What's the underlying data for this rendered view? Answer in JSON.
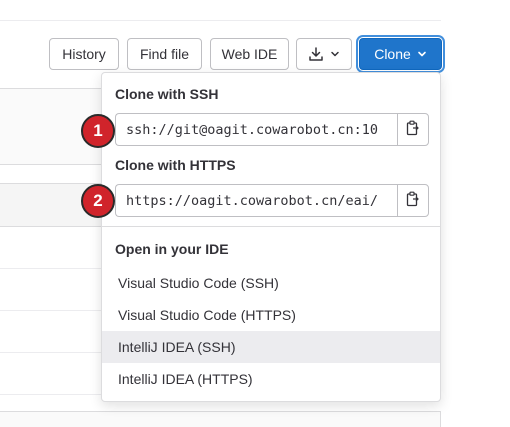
{
  "toolbar": {
    "history_label": "History",
    "find_file_label": "Find file",
    "web_ide_label": "Web IDE",
    "download_icon": "download-icon",
    "clone_label": "Clone",
    "accent_color": "#1f75cb"
  },
  "clone_dropdown": {
    "ssh": {
      "title": "Clone with SSH",
      "url": "ssh://git@oagit.cowarobot.cn:10",
      "copy_icon": "copy-to-clipboard-icon"
    },
    "https": {
      "title": "Clone with HTTPS",
      "url": "https://oagit.cowarobot.cn/eai/",
      "copy_icon": "copy-to-clipboard-icon"
    },
    "ide": {
      "title": "Open in your IDE",
      "items": [
        {
          "label": "Visual Studio Code (SSH)"
        },
        {
          "label": "Visual Studio Code (HTTPS)"
        },
        {
          "label": "IntelliJ IDEA (SSH)"
        },
        {
          "label": "IntelliJ IDEA (HTTPS)"
        }
      ]
    }
  },
  "markers": [
    {
      "label": "1",
      "color": "#d0242b"
    },
    {
      "label": "2",
      "color": "#d0242b"
    }
  ]
}
